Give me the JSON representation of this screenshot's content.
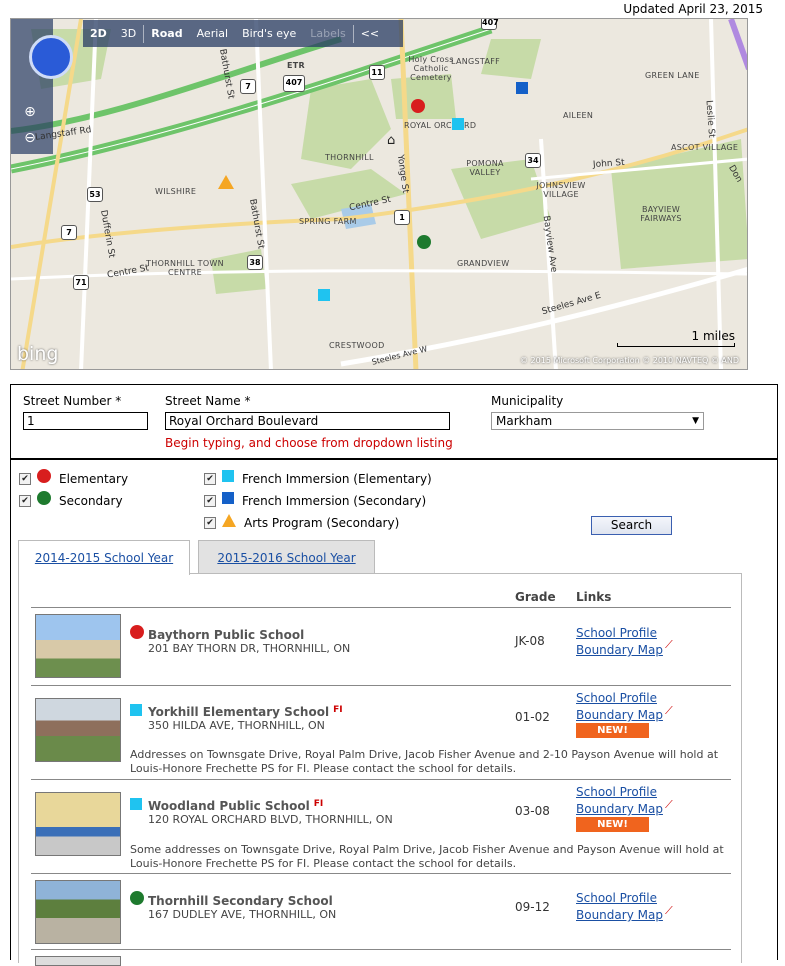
{
  "header": {
    "updated": "Updated April 23, 2015"
  },
  "map": {
    "toolbar": [
      "2D",
      "3D",
      "Road",
      "Aerial",
      "Bird's eye",
      "Labels",
      "<<"
    ],
    "brand": "bing",
    "scale": "1 miles",
    "copyright": "© 2015 Microsoft Corporation   © 2010 NAVTEQ   © AND",
    "labels": {
      "holy_cross": "Holy Cross Catholic Cemetery",
      "langstaff": "LANGSTAFF",
      "green_lane": "GREEN LANE",
      "royal_orchard": "ROYAL ORCHARD",
      "aileen": "AILEEN",
      "ascot_village": "ASCOT VILLAGE",
      "thornhill": "THORNHILL",
      "pomona_valley": "POMONA VALLEY",
      "johnsview": "JOHNSVIEW VILLAGE",
      "wilshire": "WILSHIRE",
      "spring_farm": "SPRING FARM",
      "bayview_fairways": "BAYVIEW FAIRWAYS",
      "thornhill_town_centre": "THORNHILL TOWN CENTRE",
      "grandview": "GRANDVIEW",
      "crestwood": "CRESTWOOD",
      "etr": "ETR"
    },
    "roads": {
      "langstaff_rd": "Langstaff Rd",
      "bathurst_st_top": "Bathurst St",
      "bathurst_st": "Bathurst St",
      "dufferin_st": "Dufferin St",
      "centre_st_left": "Centre St",
      "centre_st": "Centre St",
      "yonge_st": "Yonge St",
      "john_st": "John St",
      "bayview_ave": "Bayview Ave",
      "leslie_st": "Leslie St",
      "steeles_ave_e": "Steeles Ave E",
      "steeles_ave_w": "Steeles Ave W",
      "don": "Don"
    },
    "shields": [
      "407",
      "7",
      "11",
      "407",
      "34",
      "53",
      "7",
      "1",
      "38",
      "71"
    ]
  },
  "form": {
    "street_number_label": "Street Number *",
    "street_number_value": "1",
    "street_name_label": "Street Name *",
    "street_name_value": "Royal Orchard Boulevard",
    "street_name_hint": "Begin typing, and choose from dropdown listing",
    "municipality_label": "Municipality",
    "municipality_value": "Markham"
  },
  "filters": {
    "elementary": "Elementary",
    "secondary": "Secondary",
    "fi_elementary": "French Immersion (Elementary)",
    "fi_secondary": "French Immersion (Secondary)",
    "arts": "Arts Program (Secondary)",
    "search": "Search",
    "colors": {
      "elementary": "#d81e1e",
      "secondary": "#1e7a2e",
      "fi_elementary": "#1fc3f0",
      "fi_secondary": "#1460c8",
      "arts": "#f5a623"
    }
  },
  "tabs": [
    {
      "label": "2014-2015 School Year",
      "active": true
    },
    {
      "label": "2015-2016 School Year",
      "active": false
    }
  ],
  "table": {
    "grade_header": "Grade",
    "links_header": "Links",
    "profile_link": "School Profile",
    "boundary_link": "Boundary Map",
    "fi_tag": "FI",
    "new_badge": "NEW!",
    "rows": [
      {
        "name": "Baythorn Public School",
        "address": "201 BAY THORN DR, THORNHILL, ON",
        "grade": "JK-08",
        "type": "elementary",
        "fi": false,
        "new": false,
        "note": ""
      },
      {
        "name": "Yorkhill Elementary School",
        "address": "350 HILDA AVE, THORNHILL, ON",
        "grade": "01-02",
        "type": "fi_elementary",
        "fi": true,
        "new": true,
        "note": "Addresses on Townsgate Drive, Royal Palm Drive, Jacob Fisher Avenue and 2-10 Payson Avenue will hold at Louis-Honore Frechette PS for FI. Please contact the school for details."
      },
      {
        "name": "Woodland Public School",
        "address": "120 ROYAL ORCHARD BLVD, THORNHILL, ON",
        "grade": "03-08",
        "type": "fi_elementary",
        "fi": true,
        "new": true,
        "note": "Some addresses on Townsgate Drive, Royal Palm Drive, Jacob Fisher Avenue and Payson Avenue will hold at Louis-Honore Frechette PS for FI. Please contact the school for details."
      },
      {
        "name": "Thornhill Secondary School",
        "address": "167 DUDLEY AVE, THORNHILL, ON",
        "grade": "09-12",
        "type": "secondary",
        "fi": false,
        "new": false,
        "note": ""
      }
    ]
  }
}
